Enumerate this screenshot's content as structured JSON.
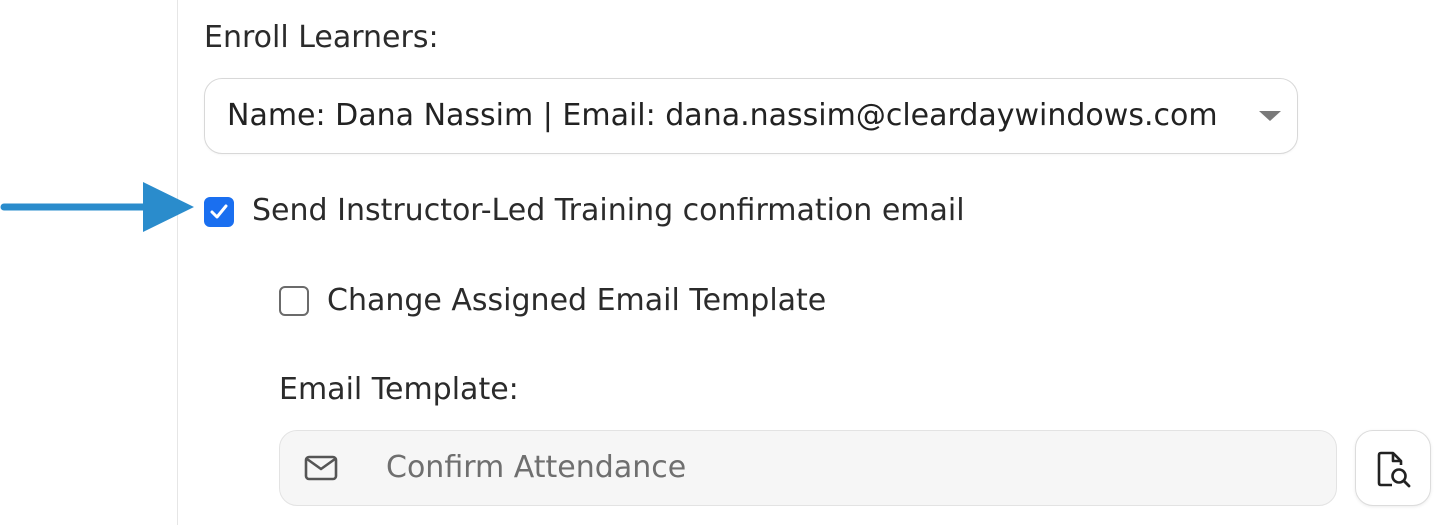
{
  "colors": {
    "accent": "#1a6ff0",
    "arrow": "#2a8ccc"
  },
  "enroll": {
    "label": "Enroll Learners:",
    "selected": "Name: Dana Nassim | Email: dana.nassim@cleardaywindows.com"
  },
  "send_confirmation": {
    "label": "Send Instructor-Led Training confirmation email",
    "checked": true
  },
  "change_template": {
    "label": "Change Assigned Email Template",
    "checked": false
  },
  "email_template": {
    "label": "Email Template:",
    "value": "Confirm Attendance",
    "icon": "envelope-icon",
    "preview_icon": "document-search-icon"
  }
}
